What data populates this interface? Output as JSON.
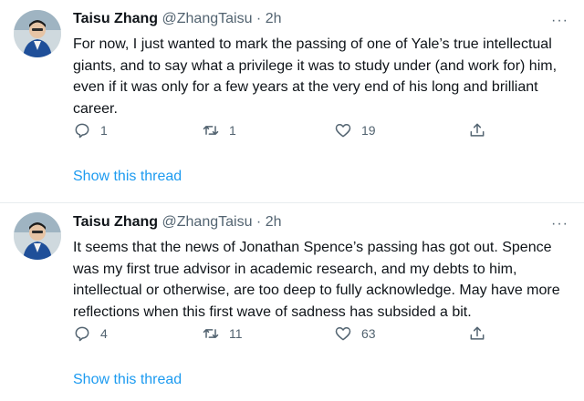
{
  "tweets": [
    {
      "name": "Taisu Zhang",
      "handle": "@ZhangTaisu",
      "separator": "·",
      "time": "2h",
      "text": "For now, I just wanted to mark the passing of one of Yale’s true intellectual giants, and to say what a privilege it was to study under (and work for) him, even if it was only for a few years at the very end of his long and brilliant career.",
      "replies": "1",
      "retweets": "1",
      "likes": "19",
      "show_thread": "Show this thread"
    },
    {
      "name": "Taisu Zhang",
      "handle": "@ZhangTaisu",
      "separator": "·",
      "time": "2h",
      "text": "It seems that the news of Jonathan Spence’s passing has got out. Spence was my first true advisor in academic research, and my debts to him, intellectual or otherwise, are too deep to fully acknowledge. May have more reflections when this first wave of sadness has subsided a bit.",
      "replies": "4",
      "retweets": "11",
      "likes": "63",
      "show_thread": "Show this thread"
    }
  ],
  "more_icon": "···",
  "colors": {
    "link": "#1d9bf0",
    "secondary": "#536471",
    "text": "#0f1419"
  }
}
